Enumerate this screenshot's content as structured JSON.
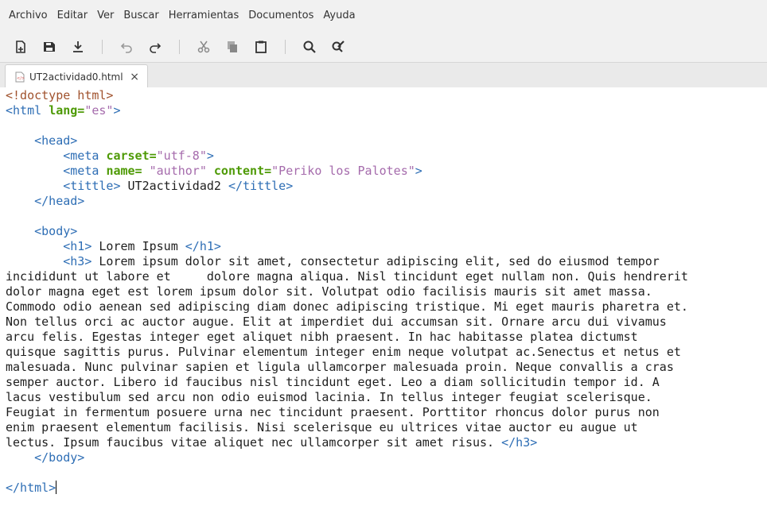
{
  "menubar": {
    "items": [
      "Archivo",
      "Editar",
      "Ver",
      "Buscar",
      "Herramientas",
      "Documentos",
      "Ayuda"
    ]
  },
  "toolbar": {
    "icons": [
      "new-document-icon",
      "save-icon",
      "download-icon",
      "undo-icon",
      "redo-icon",
      "cut-icon",
      "copy-icon",
      "paste-icon",
      "search-icon",
      "replace-icon"
    ]
  },
  "tab": {
    "filename": "UT2actividad0.html",
    "close": "×"
  },
  "code": {
    "l1": "<!doctype html>",
    "l2_open": "<html ",
    "l2_attr": "lang=",
    "l2_val": "\"es\"",
    "l2_close": ">",
    "l4": "<head>",
    "l5_open": "<meta ",
    "l5_attr": "carset=",
    "l5_val": "\"utf-8\"",
    "l5_close": ">",
    "l6_open": "<meta ",
    "l6_attr1": "name=",
    "l6_val1": " \"author\"",
    "l6_attr2": "content=",
    "l6_val2": "\"Periko los Palotes\"",
    "l6_close": ">",
    "l7_open": "<tittle>",
    "l7_text": " UT2actividad2 ",
    "l7_close": "</tittle>",
    "l8": "</head>",
    "l10": "<body>",
    "l11_open": "<h1>",
    "l11_text": " Lorem Ipsum ",
    "l11_close": "</h1>",
    "l12_open": "<h3>",
    "l12_text": " Lorem ipsum dolor sit amet, consectetur adipiscing elit, sed do eiusmod tempor",
    "l13": "incididunt ut labore et     dolore magna aliqua. Nisl tincidunt eget nullam non. Quis hendrerit",
    "l14": "dolor magna eget est lorem ipsum dolor sit. Volutpat odio facilisis mauris sit amet massa.",
    "l15": "Commodo odio aenean sed adipiscing diam donec adipiscing tristique. Mi eget mauris pharetra et.",
    "l16": "Non tellus orci ac auctor augue. Elit at imperdiet dui accumsan sit. Ornare arcu dui vivamus",
    "l17": "arcu felis. Egestas integer eget aliquet nibh praesent. In hac habitasse platea dictumst",
    "l18": "quisque sagittis purus. Pulvinar elementum integer enim neque volutpat ac.Senectus et netus et",
    "l19": "malesuada. Nunc pulvinar sapien et ligula ullamcorper malesuada proin. Neque convallis a cras",
    "l20": "semper auctor. Libero id faucibus nisl tincidunt eget. Leo a diam sollicitudin tempor id. A",
    "l21": "lacus vestibulum sed arcu non odio euismod lacinia. In tellus integer feugiat scelerisque.",
    "l22": "Feugiat in fermentum posuere urna nec tincidunt praesent. Porttitor rhoncus dolor purus non",
    "l23": "enim praesent elementum facilisis. Nisi scelerisque eu ultrices vitae auctor eu augue ut",
    "l24_text": "lectus. Ipsum faucibus vitae aliquet nec ullamcorper sit amet risus. ",
    "l24_close": "</h3>",
    "l25": "</body>",
    "l27": "</html>"
  },
  "colors": {
    "doctype": "#a0522d",
    "tag": "#2e6eb5",
    "attribute": "#4e9a06",
    "value": "#a56bac"
  }
}
